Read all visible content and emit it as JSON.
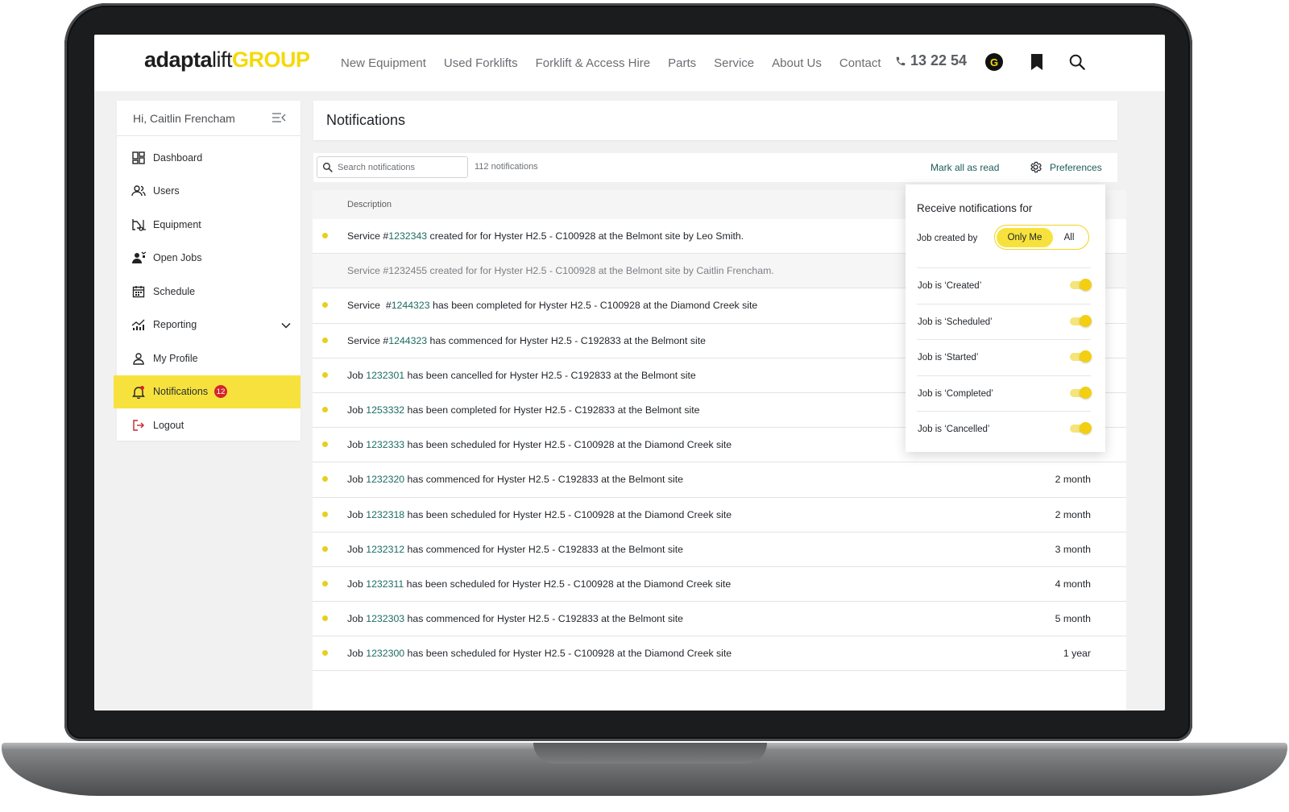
{
  "header": {
    "logo": {
      "part1": "adapta",
      "part2": "lift",
      "part3": "GROUP"
    },
    "nav": [
      {
        "label": "New Equipment",
        "name": "nav-new-equipment"
      },
      {
        "label": "Used Forklifts",
        "name": "nav-used-forklifts"
      },
      {
        "label": "Forklift & Access Hire",
        "name": "nav-forklift-access-hire"
      },
      {
        "label": "Parts",
        "name": "nav-parts"
      },
      {
        "label": "Service",
        "name": "nav-service"
      },
      {
        "label": "About Us",
        "name": "nav-about-us"
      },
      {
        "label": "Contact",
        "name": "nav-contact"
      }
    ],
    "phone": "13 22 54",
    "account_initial": "G"
  },
  "sidebar": {
    "greeting": "Hi, Caitlin Frencham",
    "items": [
      {
        "label": "Dashboard"
      },
      {
        "label": "Users"
      },
      {
        "label": "Equipment"
      },
      {
        "label": "Open Jobs"
      },
      {
        "label": "Schedule"
      },
      {
        "label": "Reporting"
      },
      {
        "label": "My Profile"
      },
      {
        "label": "Notifications",
        "badge": "12"
      },
      {
        "label": "Logout"
      }
    ]
  },
  "main": {
    "title": "Notifications",
    "search_placeholder": "Search notifications",
    "count": "112 notifications",
    "mark_all": "Mark all as read",
    "preferences": "Preferences",
    "column_description": "Description"
  },
  "rows": [
    {
      "pre": "Service #",
      "id": "1232343",
      "post": " created for for Hyster H2.5 - C100928 at the Belmont site by Leo Smith.",
      "time": "",
      "read": false
    },
    {
      "pre": "Service #",
      "id": "1232455",
      "post": " created for for Hyster H2.5 - C100928 at the Belmont site by Caitlin Frencham.",
      "time": "",
      "read": true
    },
    {
      "pre": "Service  #",
      "id": "1244323",
      "post": " has been completed for Hyster H2.5 - C100928 at the Diamond Creek site",
      "time": "",
      "read": false
    },
    {
      "pre": "Service #",
      "id": "1244323",
      "post": " has commenced for Hyster H2.5 - C192833 at the Belmont site",
      "time": "",
      "read": false
    },
    {
      "pre": "Job ",
      "id": "1232301",
      "post": " has been cancelled for Hyster H2.5 - C192833 at the Belmont site",
      "time": "",
      "read": false
    },
    {
      "pre": "Job ",
      "id": "1253332",
      "post": " has been completed for Hyster H2.5 - C192833 at the Belmont site",
      "time": "",
      "read": false
    },
    {
      "pre": "Job ",
      "id": "1232333",
      "post": " has been scheduled for Hyster H2.5 - C100928 at the Diamond Creek site",
      "time": "",
      "read": false
    },
    {
      "pre": "Job ",
      "id": "1232320",
      "post": " has commenced for Hyster H2.5 - C192833 at the Belmont site",
      "time": "2 month",
      "read": false
    },
    {
      "pre": "Job ",
      "id": "1232318",
      "post": " has been scheduled for Hyster H2.5 - C100928 at the Diamond Creek site",
      "time": "2 month",
      "read": false
    },
    {
      "pre": "Job ",
      "id": "1232312",
      "post": " has commenced for Hyster H2.5 - C192833 at the Belmont site",
      "time": "3 month",
      "read": false
    },
    {
      "pre": "Job ",
      "id": "1232311",
      "post": " has been scheduled for Hyster H2.5 - C100928 at the Diamond Creek site",
      "time": "4 month",
      "read": false
    },
    {
      "pre": "Job ",
      "id": "1232303",
      "post": " has commenced for Hyster H2.5 - C192833 at the Belmont site",
      "time": "5 month",
      "read": false
    },
    {
      "pre": "Job ",
      "id": "1232300",
      "post": " has been scheduled for Hyster H2.5 - C100928 at the Diamond Creek site",
      "time": "1 year",
      "read": false
    }
  ],
  "pref_panel": {
    "heading": "Receive notifications for",
    "job_created_by": "Job created by",
    "option_on": "Only Me",
    "option_off": "All",
    "toggles": [
      {
        "label": "Job is ‘Created’",
        "on": true
      },
      {
        "label": "Job is ‘Scheduled’",
        "on": true
      },
      {
        "label": "Job is ‘Started’",
        "on": true
      },
      {
        "label": "Job is ‘Completed’",
        "on": true
      },
      {
        "label": "Job is ‘Cancelled’",
        "on": true
      }
    ]
  },
  "colors": {
    "accent": "#f7e23d",
    "link": "#1c6b64",
    "badge": "#d6242a"
  }
}
